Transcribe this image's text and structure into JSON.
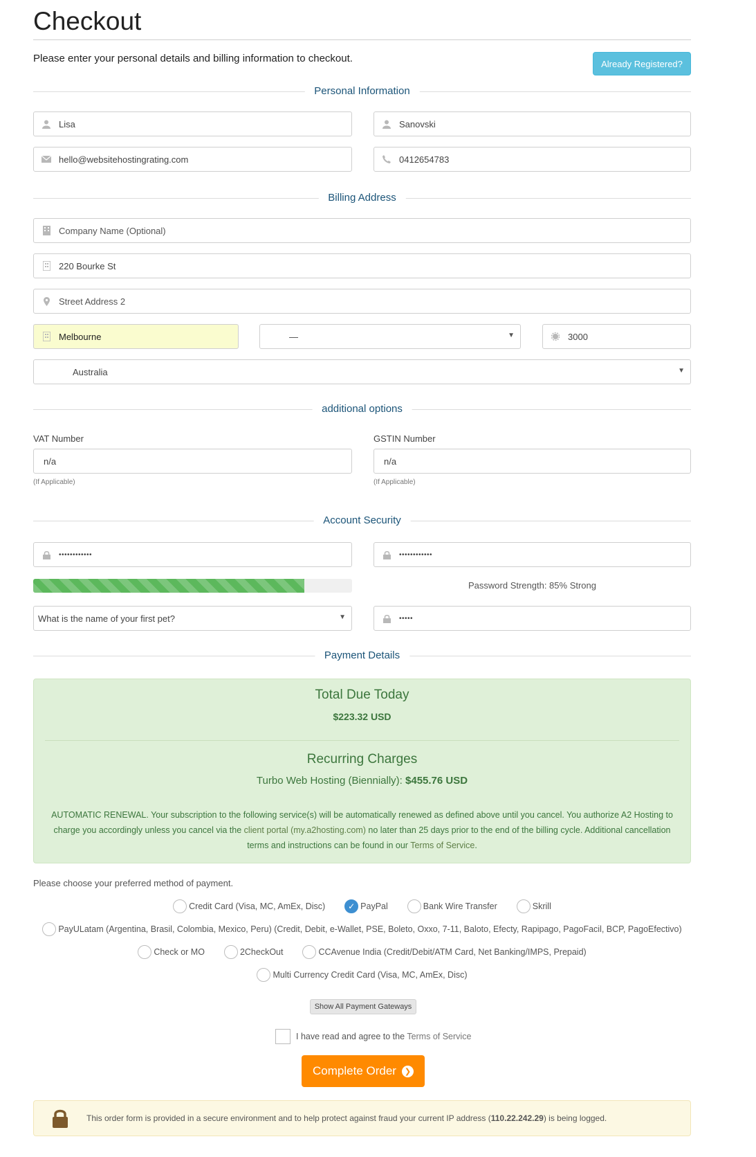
{
  "page": {
    "title": "Checkout",
    "intro": "Please enter your personal details and billing information to checkout.",
    "already_registered_label": "Already Registered?"
  },
  "sections": {
    "personal": "Personal Information",
    "billing": "Billing Address",
    "additional": "additional options",
    "security": "Account Security",
    "payment": "Payment Details"
  },
  "personal": {
    "first_name": "Lisa",
    "last_name": "Sanovski",
    "email": "hello@websitehostingrating.com",
    "phone": "0412654783"
  },
  "billing": {
    "company_placeholder": "Company Name (Optional)",
    "address1": "220 Bourke St",
    "address2_placeholder": "Street Address 2",
    "city": "Melbourne",
    "state": "—",
    "postcode": "3000",
    "country": "Australia"
  },
  "additional": {
    "vat_label": "VAT Number",
    "vat_value": "n/a",
    "vat_hint": "(If Applicable)",
    "gstin_label": "GSTIN Number",
    "gstin_value": "n/a",
    "gstin_hint": "(If Applicable)"
  },
  "security": {
    "password_mask": "••••••••••••",
    "confirm_mask": "••••••••••••",
    "strength_fraction": 0.85,
    "strength_text": "Password Strength: 85% Strong",
    "question": "What is the name of your first pet?",
    "answer_mask": "•••••"
  },
  "payment": {
    "total_heading": "Total Due Today",
    "total_amount": "$223.32 USD",
    "recurring_heading": "Recurring Charges",
    "recurring_item": "Turbo Web Hosting (Biennially):",
    "recurring_amount": "$455.76 USD",
    "renewal_part1": "AUTOMATIC RENEWAL. Your subscription to the following service(s) will be automatically renewed as defined above until you cancel. You authorize A2 Hosting to charge you accordingly unless you cancel via the",
    "renewal_link1": "client portal (my.a2hosting.com)",
    "renewal_part2": "no later than 25 days prior to the end of the billing cycle. Additional cancellation terms and instructions can be found in our",
    "renewal_link2": "Terms of Service",
    "renewal_end": ".",
    "choose_label": "Please choose your preferred method of payment.",
    "methods": {
      "credit_card": "Credit Card (Visa, MC, AmEx, Disc)",
      "paypal": "PayPal",
      "bank_wire": "Bank Wire Transfer",
      "skrill": "Skrill",
      "payulatam": "PayULatam (Argentina, Brasil, Colombia, Mexico, Peru) (Credit, Debit, e-Wallet, PSE, Boleto, Oxxo, 7-11, Baloto, Efecty, Rapipago, PagoFacil, BCP, PagoEfectivo)",
      "check_mo": "Check or MO",
      "twocheckout": "2CheckOut",
      "ccavenue": "CCAvenue India (Credit/Debit/ATM Card, Net Banking/IMPS, Prepaid)",
      "multi_currency": "Multi Currency Credit Card (Visa, MC, AmEx, Disc)"
    },
    "selected_method": "PayPal",
    "show_all_label": "Show All Payment Gateways"
  },
  "tos": {
    "text": "I have read and agree to the",
    "link": "Terms of Service"
  },
  "complete_label": "Complete Order",
  "secure": {
    "text1": "This order form is provided in a secure environment and to help protect against fraud your current IP address (",
    "ip": "110.22.242.29",
    "text2": ") is being logged."
  },
  "colors": {
    "info_button": "#5bc0de",
    "section_heading": "#1b5478",
    "success_bg": "#dff0d8",
    "success_text": "#3c763d",
    "progress": "#5cb85c",
    "order_button": "#ff8a00",
    "warning_bg": "#fcf8e3",
    "autofill_bg": "#fafccf",
    "radio_selected": "#3d8fd1"
  },
  "icons": {
    "name": "user-icon",
    "email": "envelope-icon",
    "phone": "phone-icon",
    "company": "building-icon",
    "address": "building-icon",
    "address2": "map-marker-icon",
    "city": "building-icon",
    "postcode": "cog-icon",
    "password": "lock-icon",
    "order": "arrow-circle-right-icon",
    "secure": "padlock-icon"
  }
}
